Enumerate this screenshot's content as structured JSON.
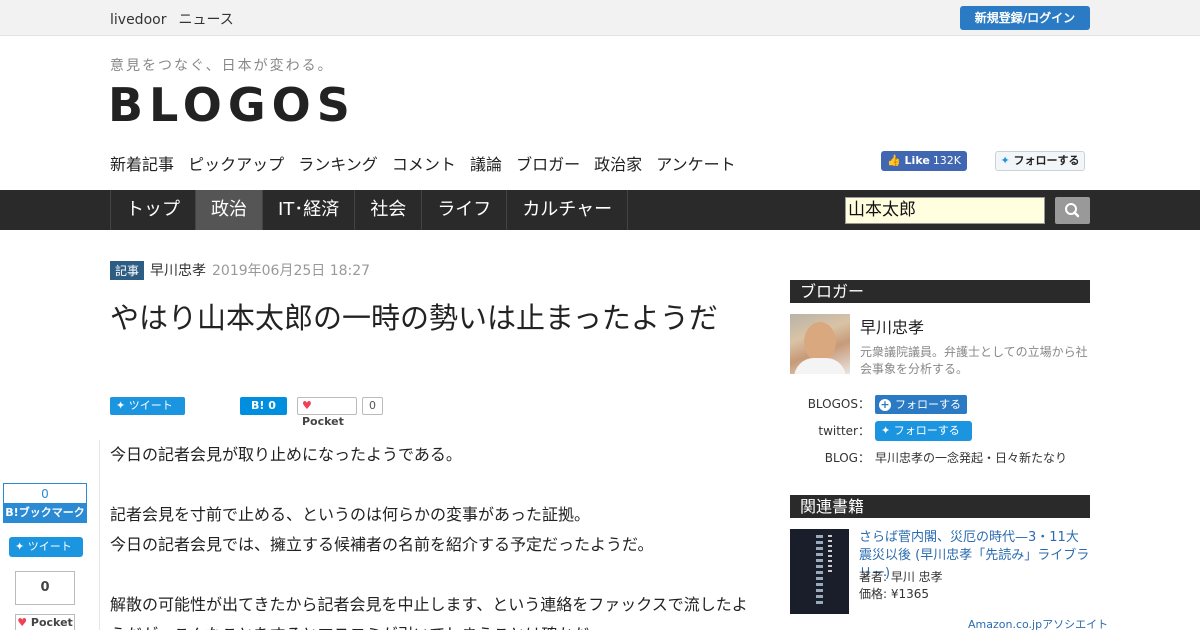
{
  "topbar": {
    "brand_left": "livedoor",
    "brand_right": "ニュース",
    "login_label": "新規登録/ログイン"
  },
  "header": {
    "tagline": "意見をつなぐ、日本が変わる。",
    "logo": "BLOGOS",
    "subnav": [
      "新着記事",
      "ピックアップ",
      "ランキング",
      "コメント",
      "議論",
      "ブロガー",
      "政治家",
      "アンケート"
    ],
    "fb_like_label": "Like",
    "fb_like_count": "132K",
    "tw_follow_label": "フォローする"
  },
  "mainnav": {
    "tabs": [
      "トップ",
      "政治",
      "IT･経済",
      "社会",
      "ライフ",
      "カルチャー"
    ],
    "active_tab": "政治",
    "search_value": "山本太郎"
  },
  "article": {
    "badge": "記事",
    "author": "早川忠孝",
    "date": "2019年06月25日 18:27",
    "title": "やはり山本太郎の一時の勢いは止まったようだ",
    "share": {
      "tweet": "ツイート",
      "hatena": "B!",
      "hatena_count": "0",
      "pocket": "Pocket",
      "pocket_count": "0"
    },
    "paragraphs": [
      "今日の記者会見が取り止めになったようである。",
      "",
      "記者会見を寸前で止める、というのは何らかの変事があった証拠。",
      "今日の記者会見では、擁立する候補者の名前を紹介する予定だったようだ。",
      "",
      "解散の可能性が出てきたから記者会見を中止します、という連絡をファックスで流したよ",
      "うだが、こんなことをするとマスコミが引いてしまうことは確かだ。"
    ]
  },
  "floatbar": {
    "hatena_count": "0",
    "hatena_label": "B!ブックマーク",
    "tweet": "ツイート",
    "pocket_count": "0",
    "pocket": "Pocket"
  },
  "sidebar": {
    "blogger_heading": "ブロガー",
    "blogger_name": "早川忠孝",
    "blogger_desc": "元衆議院議員。弁護士としての立場から社会事象を分析する。",
    "blogos_label": "BLOGOS：",
    "blogos_follow": "フォローする",
    "twitter_label": "twitter：",
    "twitter_follow": "フォローする",
    "blog_label": "BLOG：",
    "blog_name": "早川忠孝の一念発起・日々新たなり",
    "books_heading": "関連書籍",
    "book_title": "さらば菅内閣、災厄の時代—3・11大震災以後 (早川忠孝「先読み」ライブラリー)",
    "book_author": "著者: 早川 忠孝",
    "book_price": "価格: ¥1365",
    "amazon": "Amazon.co.jpアソシエイト"
  }
}
